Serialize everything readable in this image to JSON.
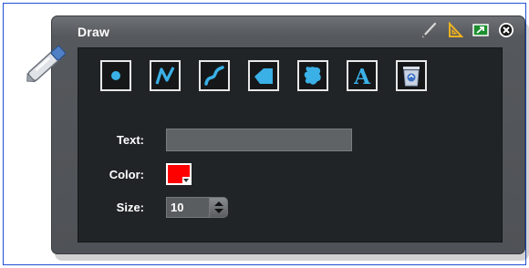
{
  "window": {
    "title": "Draw",
    "header_icons": [
      "pencil-icon",
      "triangle-ruler-icon",
      "dock-icon",
      "close-icon"
    ]
  },
  "tools": [
    {
      "name": "point-tool",
      "icon": "dot-icon"
    },
    {
      "name": "polyline-tool",
      "icon": "polyline-icon"
    },
    {
      "name": "freehand-tool",
      "icon": "freehand-icon"
    },
    {
      "name": "polygon-tool",
      "icon": "polygon-icon"
    },
    {
      "name": "freehand-polygon-tool",
      "icon": "blob-icon"
    },
    {
      "name": "text-tool",
      "icon": "letter-a-icon"
    },
    {
      "name": "delete-tool",
      "icon": "trash-icon"
    }
  ],
  "form": {
    "text_label": "Text:",
    "text_value": "",
    "color_label": "Color:",
    "color_value": "#ff0000",
    "size_label": "Size:",
    "size_value": "10"
  },
  "colors": {
    "accent": "#3ab0e6",
    "panel": "#55585c",
    "content_bg": "#202427",
    "frame_border": "#1f4fd6"
  }
}
